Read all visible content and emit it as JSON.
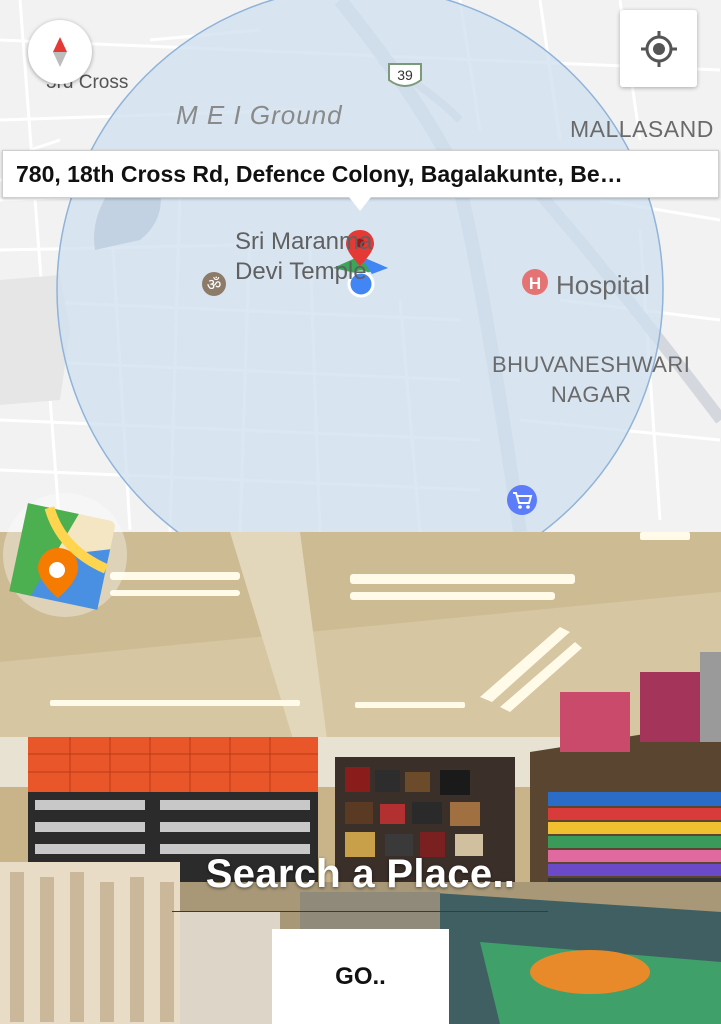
{
  "map": {
    "compass_icon": "compass-icon",
    "locate_icon": "my-location-icon",
    "labels": {
      "street_3rd_cross": "3rd Cross",
      "mei_ground": "M E I Ground",
      "mallasand": "MALLASAND",
      "temple_line1": "Sri Maranma",
      "temple_line2": "Devi Temple",
      "hospital": "Hospital",
      "bhuvaneshwari_line1": "BHUVANESHWARI",
      "bhuvaneshwari_line2": "NAGAR",
      "highway_shield": "39"
    },
    "address": "780, 18th Cross Rd, Defence Colony, Bagalakunte, Be…",
    "colors": {
      "radius_fill": "#cfe0f0",
      "radius_stroke": "#8fb3d9",
      "location_dot": "#4285f4",
      "pin": "#e53935",
      "hospital": "#e57373",
      "shopping": "#5c7cfa"
    }
  },
  "street_view": {
    "logo_icon": "google-maps-logo-icon"
  },
  "search": {
    "title": "Search a Place..",
    "go_label": "GO.."
  }
}
